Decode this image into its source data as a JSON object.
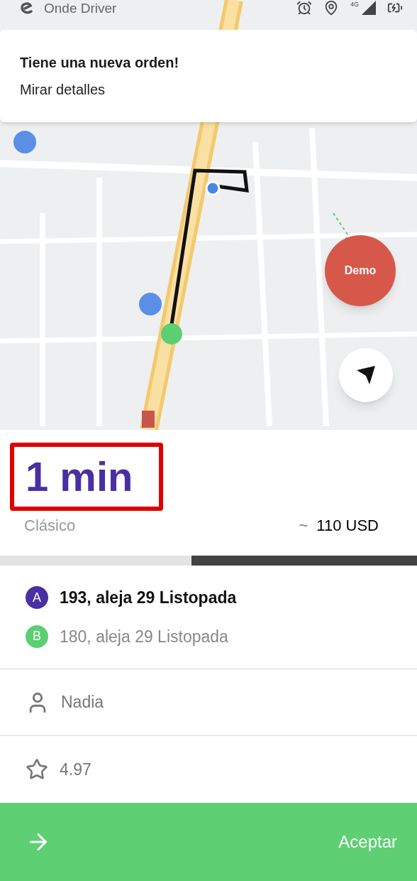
{
  "status_bar": {
    "app_name": "Onde Driver",
    "network": "4G"
  },
  "notification": {
    "title": "Tiene una nueva orden!",
    "subtitle": "Mirar detalles"
  },
  "map": {
    "kind": "picture",
    "demo_button": "Demo"
  },
  "order": {
    "eta": "1 min",
    "eta_highlighted": true,
    "service": "Clásico",
    "price_prefix": "~",
    "price": "110 USD"
  },
  "timer": {
    "level": 0.54
  },
  "stops": [
    {
      "badge": "A",
      "address": "193, aleja 29 Listopada",
      "color": "#4a2fa3",
      "selected": true
    },
    {
      "badge": "B",
      "address": "180, aleja 29 Listopada",
      "color": "#5ccf73",
      "selected": false
    }
  ],
  "passenger": {
    "name": "Nadia"
  },
  "rating": {
    "value": "4.97"
  },
  "accept_button": {
    "label": "Aceptar"
  }
}
